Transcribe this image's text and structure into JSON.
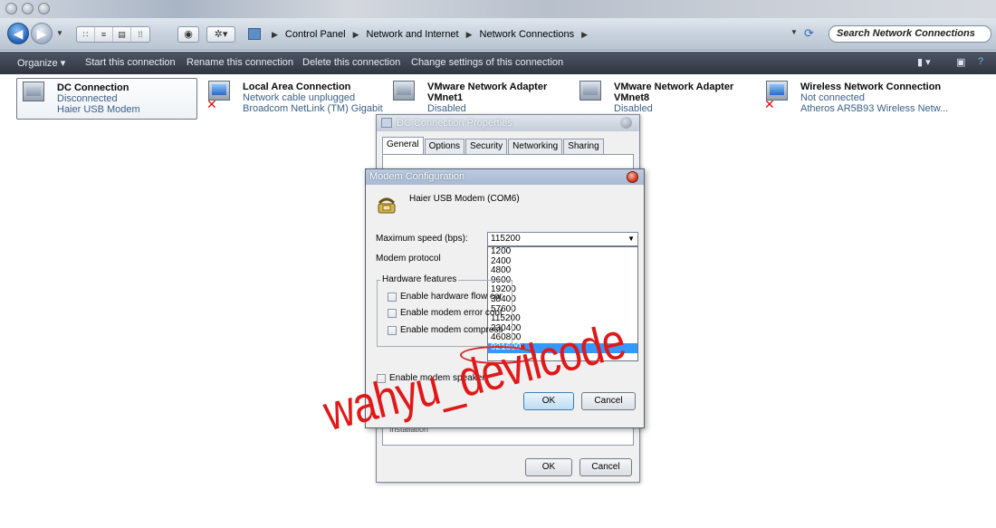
{
  "address_bar": {
    "breadcrumbs": [
      "Control Panel",
      "Network and Internet",
      "Network Connections"
    ],
    "search_placeholder": "Search Network Connections"
  },
  "command_bar": {
    "organize": "Organize ▾",
    "start": "Start this connection",
    "rename": "Rename this connection",
    "delete": "Delete this connection",
    "change": "Change settings of this connection"
  },
  "connections": [
    {
      "name": "DC Connection",
      "status": "Disconnected",
      "device": "Haier USB Modem",
      "icon": "modem-icon"
    },
    {
      "name": "Local Area Connection",
      "status": "Network cable unplugged",
      "device": "Broadcom NetLink (TM) Gigabit",
      "icon": "lan-icon"
    },
    {
      "name": "VMware Network Adapter",
      "name2": "VMnet1",
      "status": "Disabled",
      "icon": "network-adapter-icon"
    },
    {
      "name": "VMware Network Adapter",
      "name2": "VMnet8",
      "status": "Disabled",
      "icon": "network-adapter-icon"
    },
    {
      "name": "Wireless Network Connection",
      "status": "Not connected",
      "device": "Atheros AR5B93 Wireless Netw...",
      "icon": "wireless-icon"
    }
  ],
  "properties_dialog": {
    "title": "DC Connection Properties",
    "tabs": [
      "General",
      "Options",
      "Security",
      "Networking",
      "Sharing"
    ],
    "ok": "OK",
    "cancel": "Cancel",
    "partial_text": "Installation"
  },
  "modem_dialog": {
    "title": "Modem Configuration",
    "device": "Haier USB Modem (COM6)",
    "max_speed_label": "Maximum speed (bps):",
    "max_speed_value": "115200",
    "protocol_label": "Modem protocol",
    "hardware_features": "Hardware features",
    "checkboxes": [
      "Enable hardware flow con",
      "Enable modem error contro",
      "Enable modem compressio"
    ],
    "speaker": "Enable modem speaker",
    "speed_options": [
      "1200",
      "2400",
      "4800",
      "9600",
      "19200",
      "38400",
      "57600",
      "115200",
      "230400",
      "460800",
      "921600"
    ],
    "selected_option": "921600",
    "ok": "OK",
    "cancel": "Cancel"
  },
  "watermark": "wahyu_devilcode",
  "colors": {
    "command_bar": "#3a424d",
    "selection": "#3399ff",
    "watermark": "#e01818",
    "status_text": "#3a5f86"
  }
}
